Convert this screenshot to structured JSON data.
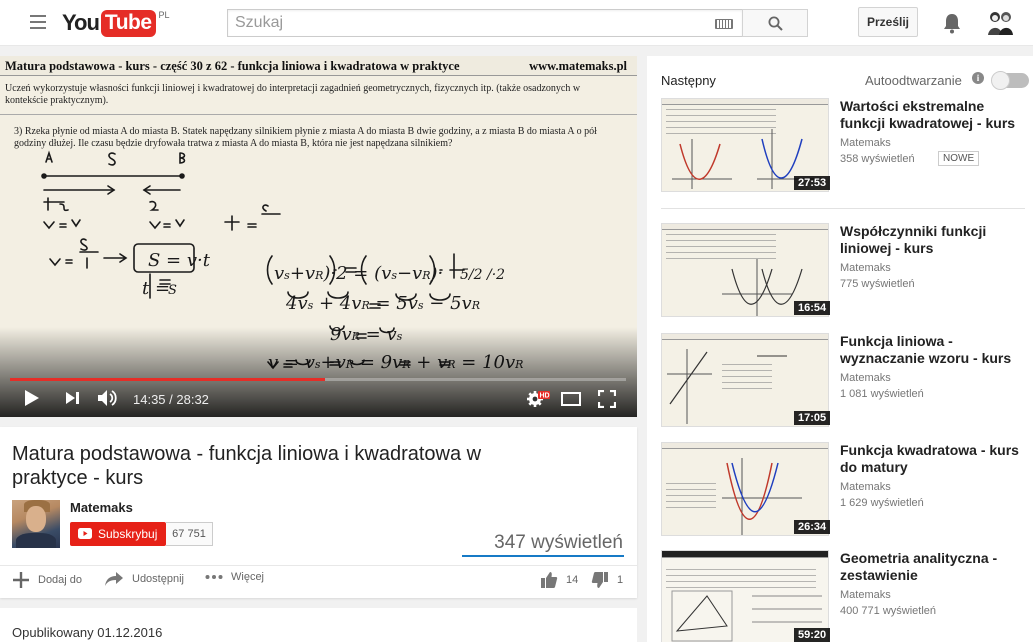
{
  "header": {
    "logo_text_left": "You",
    "logo_text_right": "Tube",
    "country_code": "PL",
    "search_placeholder": "Szukaj",
    "upload_label": "Prześlij"
  },
  "player": {
    "slide_title": "Matura podstawowa - kurs - część 30 z 62 - funkcja liniowa i kwadratowa w praktyce",
    "slide_site": "www.matemaks.pl",
    "slide_intro": "Uczeń wykorzystuje własności funkcji liniowej i kwadratowej do interpretacji zagadnień geometrycznych, fizycznych itp. (także osadzonych w kontekście praktycznym).",
    "slide_task": "3) Rzeka płynie od miasta A do miasta B. Statek napędzany silnikiem płynie z miasta A do miasta B dwie godziny, a z miasta B do miasta A o pół godziny dłużej. Ile czasu będzie dryfowała tratwa z miasta A do miasta B, która nie jest napędzana silnikiem?",
    "current_time": "14:35",
    "duration": "28:32",
    "time_text": "14:35 / 28:32",
    "progress_fraction": 0.511
  },
  "video": {
    "title": "Matura podstawowa - funkcja liniowa i kwadratowa w praktyce - kurs",
    "channel": "Matemaks",
    "subscribe_label": "Subskrybuj",
    "subscriber_count": "67 751",
    "views": "347 wyświetleń",
    "add_label": "Dodaj do",
    "share_label": "Udostępnij",
    "more_label": "Więcej",
    "likes": "14",
    "dislikes": "1",
    "published": "Opublikowany 01.12.2016"
  },
  "sidebar": {
    "next_label": "Następny",
    "autoplay_label": "Autoodtwarzanie",
    "autoplay_on": false,
    "items": [
      {
        "title": "Wartości ekstremalne funkcji kwadratowej - kurs",
        "channel": "Matemaks",
        "views": "358 wyświetleń",
        "badge": "NOWE",
        "duration": "27:53"
      },
      {
        "title": "Współczynniki funkcji liniowej - kurs",
        "channel": "Matemaks",
        "views": "775 wyświetleń",
        "duration": "16:54"
      },
      {
        "title": "Funkcja liniowa - wyznaczanie wzoru - kurs",
        "channel": "Matemaks",
        "views": "1 081 wyświetleń",
        "duration": "17:05"
      },
      {
        "title": "Funkcja kwadratowa - kurs do matury",
        "channel": "Matemaks",
        "views": "1 629 wyświetleń",
        "duration": "26:34"
      },
      {
        "title": "Geometria analityczna - zestawienie",
        "channel": "Matemaks",
        "views": "400 771 wyświetleń",
        "duration": "59:20"
      }
    ]
  },
  "colors": {
    "brand_red": "#e52d27",
    "link_blue": "#167ac6"
  }
}
